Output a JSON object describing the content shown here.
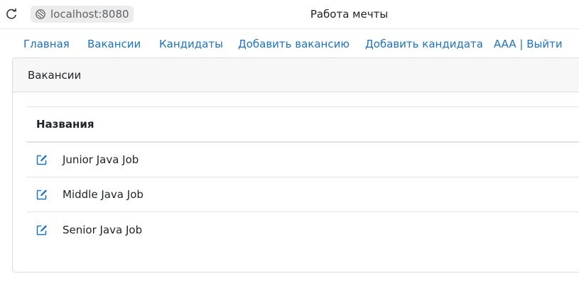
{
  "browser": {
    "url": "localhost:8080",
    "tab_title": "Работа мечты"
  },
  "nav": {
    "items": [
      {
        "label": "Главная"
      },
      {
        "label": "Вакансии"
      },
      {
        "label": "Кандидаты"
      },
      {
        "label": "Добавить вакансию"
      },
      {
        "label": "Добавить кандидата"
      },
      {
        "label": "AAA | Выйти"
      }
    ]
  },
  "card": {
    "header": "Вакансии",
    "table": {
      "column_header": "Названия",
      "rows": [
        {
          "title": "Junior Java Job"
        },
        {
          "title": "Middle Java Job"
        },
        {
          "title": "Senior Java Job"
        }
      ]
    }
  },
  "colors": {
    "link": "#1a73c8",
    "icon": "#1a73c8"
  },
  "icons": [
    "reload-icon",
    "site-info-icon",
    "edit-icon"
  ]
}
